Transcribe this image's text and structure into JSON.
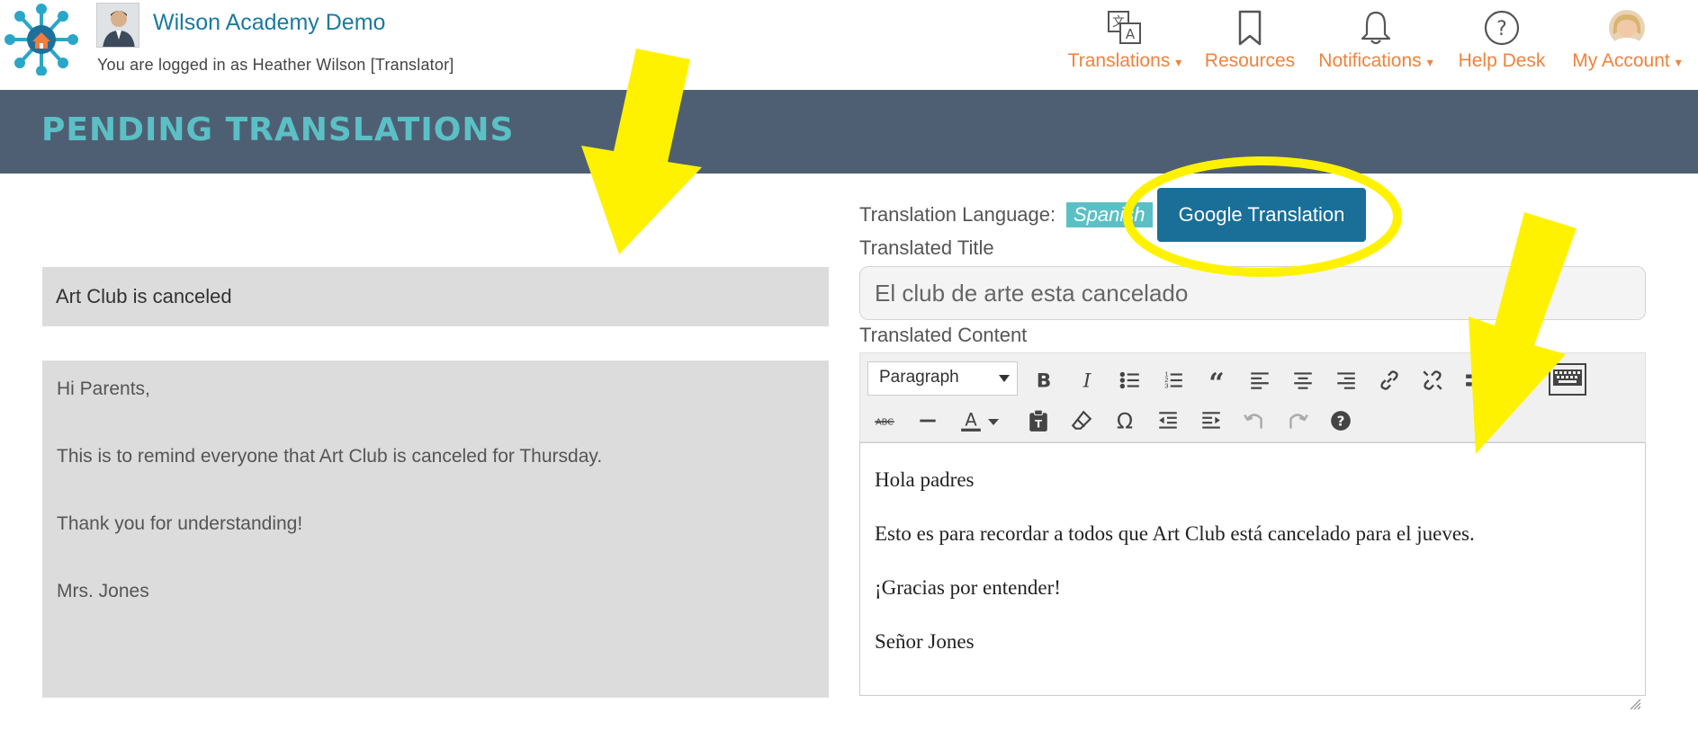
{
  "header": {
    "school_name": "Wilson Academy Demo",
    "logged_in_text": "You are logged in as Heather Wilson [Translator]"
  },
  "nav": [
    {
      "label": "Translations",
      "icon": "translate-icon",
      "has_dropdown": true
    },
    {
      "label": "Resources",
      "icon": "bookmark-icon",
      "has_dropdown": false
    },
    {
      "label": "Notifications",
      "icon": "bell-icon",
      "has_dropdown": true
    },
    {
      "label": "Help Desk",
      "icon": "help-circle-icon",
      "has_dropdown": false
    },
    {
      "label": "My Account",
      "icon": "avatar",
      "has_dropdown": true
    }
  ],
  "caret": "▾",
  "banner": {
    "title": "PENDING TRANSLATIONS"
  },
  "original": {
    "title": "Art Club is canceled",
    "content": [
      "Hi Parents,",
      "This is to remind everyone that Art Club is canceled for Thursday.",
      "Thank you for understanding!",
      "Mrs. Jones"
    ]
  },
  "translation": {
    "language_label": "Translation Language:",
    "language": "Spanish",
    "google_button": "Google Translation",
    "title_label": "Translated Title",
    "title_value": "El club de arte esta cancelado",
    "content_label": "Translated Content",
    "block_format": "Paragraph",
    "content": [
      "Hola padres",
      "Esto es para recordar a todos que Art Club está cancelado para el jueves.",
      "¡Gracias por entender!",
      "Señor Jones"
    ]
  },
  "toolbar": {
    "row1": [
      "bold-icon",
      "italic-icon",
      "bullet-list-icon",
      "numbered-list-icon",
      "blockquote-icon",
      "align-left-icon",
      "align-center-icon",
      "align-right-icon",
      "link-icon",
      "unlink-icon",
      "more-icon",
      "keyboard-icon"
    ],
    "row2": [
      "strikethrough-icon",
      "horizontal-line-icon",
      "text-color-icon",
      "paste-as-text-icon",
      "clear-formatting-icon",
      "special-character-icon",
      "outdent-icon",
      "indent-icon",
      "undo-icon",
      "redo-icon",
      "help-icon"
    ]
  },
  "colors": {
    "brand_teal": "#5bc0c5",
    "nav_orange": "#f0823c",
    "banner_bg": "#4f5f73",
    "button_blue": "#1a6f98",
    "annotation_yellow": "#fff200"
  }
}
